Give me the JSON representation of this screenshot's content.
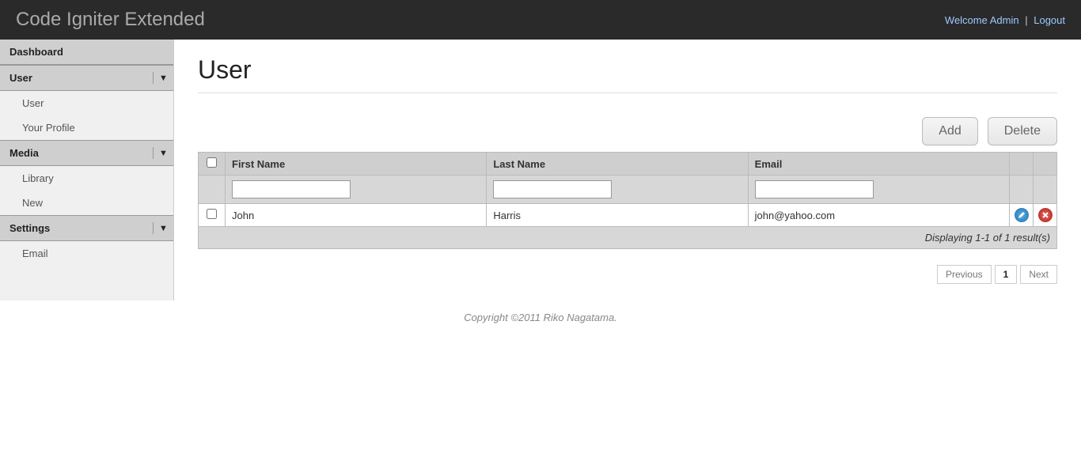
{
  "header": {
    "brand": "Code Igniter Extended",
    "welcome": "Welcome Admin",
    "logout": "Logout"
  },
  "sidebar": {
    "dashboard": "Dashboard",
    "user": {
      "label": "User",
      "items": [
        "User",
        "Your Profile"
      ]
    },
    "media": {
      "label": "Media",
      "items": [
        "Library",
        "New"
      ]
    },
    "settings": {
      "label": "Settings",
      "items": [
        "Email"
      ]
    }
  },
  "page": {
    "title": "User",
    "add": "Add",
    "delete": "Delete"
  },
  "table": {
    "headers": {
      "first_name": "First Name",
      "last_name": "Last Name",
      "email": "Email"
    },
    "rows": [
      {
        "first_name": "John",
        "last_name": "Harris",
        "email": "john@yahoo.com"
      }
    ],
    "footer": "Displaying 1-1 of 1 result(s)"
  },
  "pager": {
    "prev": "Previous",
    "current": "1",
    "next": "Next"
  },
  "footer": "Copyright ©2011 Riko Nagatama."
}
